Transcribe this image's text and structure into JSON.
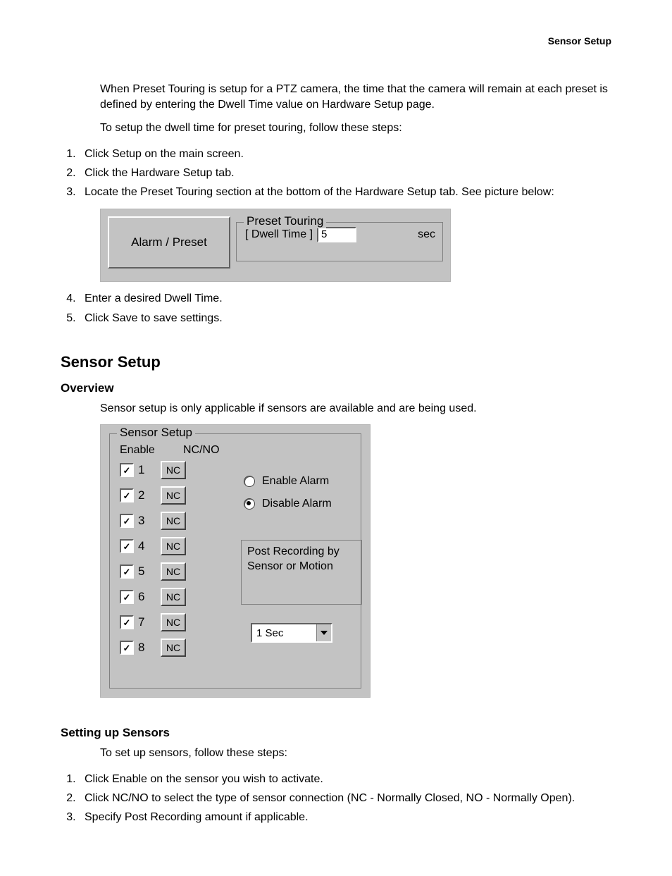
{
  "header": {
    "right": "Sensor Setup"
  },
  "intro": {
    "p1": "When Preset Touring is setup for a PTZ camera, the time that the camera will remain at each preset is defined by entering the Dwell Time value on Hardware Setup page.",
    "p2": "To setup the dwell time for preset touring, follow these steps:"
  },
  "steps1": [
    "Click Setup on the main screen.",
    "Click the Hardware Setup tab.",
    "Locate the Preset Touring section at the bottom of the Hardware Setup tab. See picture below:"
  ],
  "panel1": {
    "button": "Alarm / Preset",
    "legend": "Preset Touring",
    "dwell_label": "[ Dwell Time ]",
    "dwell_value": "5",
    "unit": "sec"
  },
  "steps1b": [
    "Enter a desired Dwell Time.",
    "Click Save to save settings."
  ],
  "section": {
    "title": "Sensor Setup"
  },
  "overview": {
    "heading": "Overview",
    "text": "Sensor setup is only applicable if sensors are available and are being used."
  },
  "panel2": {
    "legend": "Sensor Setup",
    "col_enable": "Enable",
    "col_ncno": "NC/NO",
    "rows": [
      {
        "n": "1",
        "checked": true,
        "mode": "NC"
      },
      {
        "n": "2",
        "checked": true,
        "mode": "NC"
      },
      {
        "n": "3",
        "checked": true,
        "mode": "NC"
      },
      {
        "n": "4",
        "checked": true,
        "mode": "NC"
      },
      {
        "n": "5",
        "checked": true,
        "mode": "NC"
      },
      {
        "n": "6",
        "checked": true,
        "mode": "NC"
      },
      {
        "n": "7",
        "checked": true,
        "mode": "NC"
      },
      {
        "n": "8",
        "checked": true,
        "mode": "NC"
      }
    ],
    "radio_enable": "Enable Alarm",
    "radio_disable": "Disable Alarm",
    "radio_selected": "disable",
    "post_label": "Post Recording by Sensor or Motion",
    "dropdown_value": "1 Sec"
  },
  "setting_up": {
    "heading": "Setting up Sensors",
    "intro": "To set up sensors, follow these steps:",
    "steps": [
      "Click Enable on the sensor you wish to activate.",
      "Click NC/NO to select the type of sensor connection (NC - Normally Closed, NO - Normally Open).",
      "Specify Post Recording amount if applicable."
    ]
  }
}
